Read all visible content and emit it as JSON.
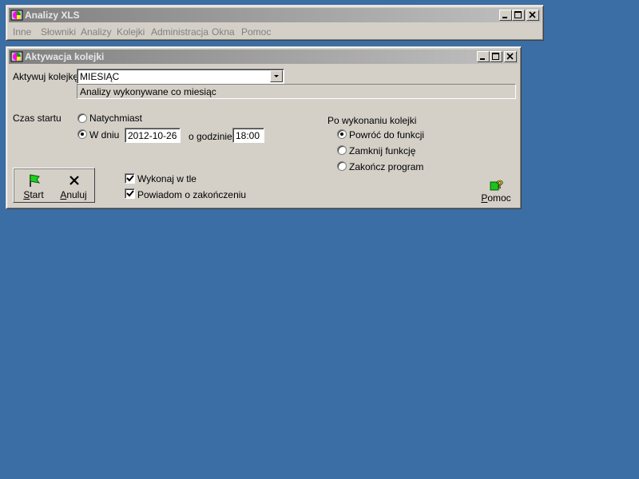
{
  "main_window": {
    "title": "Analizy XLS",
    "menu": [
      "Inne",
      "Słowniki",
      "Analizy",
      "Kolejki",
      "Administracja",
      "Okna",
      "Pomoc"
    ]
  },
  "dialog": {
    "title": "Aktywacja kolejki",
    "queue_label": "Aktywuj kolejkę",
    "queue_value": "MIESIĄC",
    "queue_description": "Analizy wykonywane co miesiąc",
    "start_time_label": "Czas startu",
    "option_immediately": "Natychmiast",
    "option_on_day": "W dniu",
    "date_value": "2012-10-26",
    "at_hour_label": "o godzinie",
    "time_value": "18:00",
    "after_label": "Po wykonaniu kolejki",
    "after_options": [
      "Powróć do funkcji",
      "Zamknij funkcję",
      "Zakończ program"
    ],
    "after_selected": 0,
    "start_selected": "on_day",
    "start_button": "Start",
    "cancel_button": "Anuluj",
    "background_check": "Wykonaj w tle",
    "notify_check": "Powiadom o zakończeniu",
    "help_button": "Pomoc"
  },
  "colors": {
    "desktop": "#3a6ea5",
    "window": "#d4d0c8",
    "inactive_title": "#808080"
  },
  "icons": [
    "app-icon",
    "minimize-icon",
    "maximize-icon",
    "close-icon",
    "flag-icon",
    "x-icon",
    "help-icon",
    "dropdown-arrow-icon",
    "checkmark-icon"
  ]
}
